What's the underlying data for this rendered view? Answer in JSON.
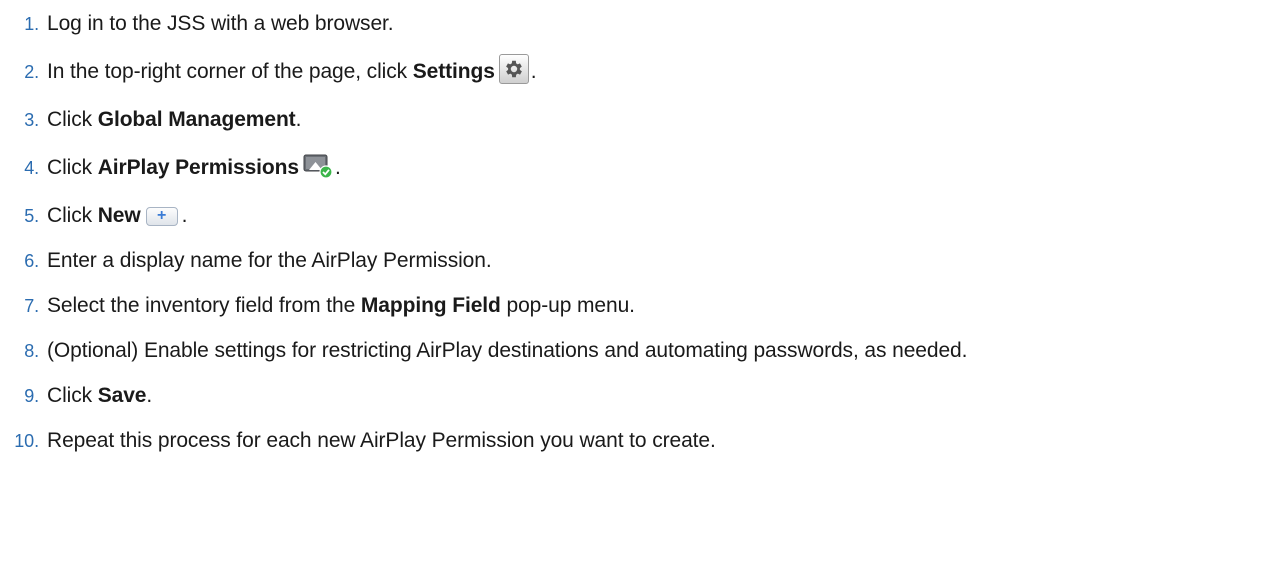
{
  "steps": [
    {
      "number": "1.",
      "parts": [
        "Log in to the JSS with a web browser."
      ]
    },
    {
      "number": "2.",
      "parts": [
        "In the top-right corner of the page, click ",
        "Settings",
        "."
      ],
      "icon": "gear-icon"
    },
    {
      "number": "3.",
      "parts": [
        "Click ",
        "Global Management",
        "."
      ]
    },
    {
      "number": "4.",
      "parts": [
        "Click ",
        "AirPlay Permissions",
        "."
      ],
      "icon": "airplay-permissions-icon"
    },
    {
      "number": "5.",
      "parts": [
        "Click ",
        "New",
        "."
      ],
      "icon": "plus-icon",
      "icon_label": "+"
    },
    {
      "number": "6.",
      "parts": [
        "Enter a display name for the AirPlay Permission."
      ]
    },
    {
      "number": "7.",
      "parts": [
        "Select the inventory field from the ",
        "Mapping Field",
        " pop-up menu."
      ]
    },
    {
      "number": "8.",
      "parts": [
        "(Optional) Enable settings for restricting AirPlay destinations and automating passwords, as needed."
      ]
    },
    {
      "number": "9.",
      "parts": [
        "Click ",
        "Save",
        "."
      ]
    },
    {
      "number": "10.",
      "parts": [
        "Repeat this process for each new AirPlay Permission you want to create."
      ]
    }
  ],
  "colors": {
    "number": "#2b6cb0",
    "text": "#1a1a1a",
    "airplay_check": "#3bb54a"
  }
}
